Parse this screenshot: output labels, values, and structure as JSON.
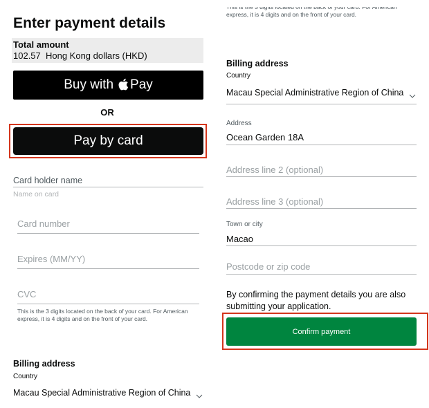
{
  "page": {
    "title": "Enter payment details",
    "total_label": "Total amount",
    "total_value": "102.57  Hong Kong dollars (HKD)"
  },
  "buttons": {
    "apple_pay_prefix": "Buy with",
    "apple_pay_suffix": "Pay",
    "or": "OR",
    "pay_by_card": "Pay by card",
    "confirm": "Confirm payment"
  },
  "card_form": {
    "holder_label": "Card holder name",
    "holder_hint": "Name on card",
    "number_placeholder": "Card number",
    "expires_placeholder": "Expires (MM/YY)",
    "cvc_placeholder": "CVC",
    "cvc_help": "This is the 3 digits located on the back of your card. For American express, it is 4 digits and on the front of your card."
  },
  "billing": {
    "title": "Billing address",
    "country_label": "Country",
    "country_value": "Macau Special Administrative Region of China",
    "address_label": "Address",
    "address_value": "Ocean Garden 18A",
    "address2_placeholder": "Address line 2 (optional)",
    "address3_placeholder": "Address line 3 (optional)",
    "town_label": "Town or city",
    "town_value": "Macao",
    "postcode_placeholder": "Postcode or zip code"
  },
  "confirmation": {
    "notice": "By confirming the payment details you are also submitting your application."
  },
  "colors": {
    "highlight": "#d4351c",
    "confirm_green": "#00853f",
    "amount_bg": "#ececec"
  },
  "icons": [
    "apple-logo-icon",
    "chevron-down-icon"
  ]
}
